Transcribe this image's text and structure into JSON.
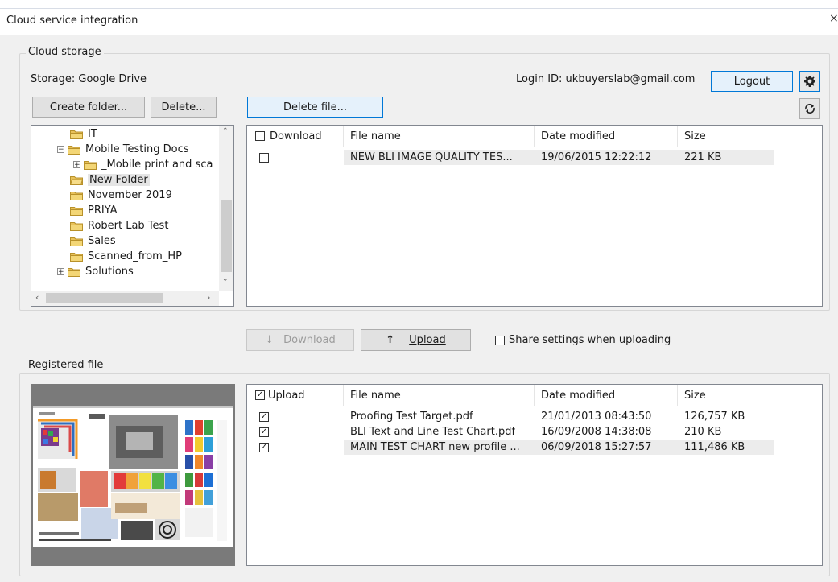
{
  "window": {
    "title": "Cloud service integration",
    "close_glyph": "×"
  },
  "cloud_storage": {
    "group_label": "Cloud storage",
    "storage_label": "Storage: Google Drive",
    "login_id": "Login ID: ukbuyerslab@gmail.com",
    "logout_label": "Logout",
    "create_folder_label": "Create folder...",
    "delete_label": "Delete...",
    "delete_file_label": "Delete file...",
    "tree": [
      {
        "label": "IT",
        "expander": ""
      },
      {
        "label": "Mobile Testing Docs",
        "expander": "−"
      },
      {
        "label": "_Mobile print and sca",
        "expander": "+"
      },
      {
        "label": "New Folder",
        "expander": "",
        "selected": true,
        "open": true
      },
      {
        "label": "November 2019",
        "expander": ""
      },
      {
        "label": "PRIYA",
        "expander": ""
      },
      {
        "label": "Robert Lab Test",
        "expander": ""
      },
      {
        "label": "Sales",
        "expander": ""
      },
      {
        "label": "Scanned_from_HP",
        "expander": ""
      },
      {
        "label": "Solutions",
        "expander": "+"
      }
    ],
    "file_columns": [
      "Download",
      "File name",
      "Date modified",
      "Size"
    ],
    "files": [
      {
        "name": "NEW BLI IMAGE QUALITY TES...",
        "date": "19/06/2015 12:22:12",
        "size": "221 KB",
        "checked": false
      }
    ]
  },
  "transfer": {
    "download_label": "Download",
    "upload_label": "Upload",
    "share_label": "Share settings when uploading"
  },
  "registered": {
    "group_label": "Registered file",
    "columns": [
      "Upload",
      "File name",
      "Date modified",
      "Size"
    ],
    "files": [
      {
        "name": "Proofing Test Target.pdf",
        "date": "21/01/2013 08:43:50",
        "size": "126,757 KB",
        "checked": true
      },
      {
        "name": "BLI Text and Line Test Chart.pdf",
        "date": "16/09/2008 14:38:08",
        "size": "210 KB",
        "checked": true
      },
      {
        "name": "MAIN TEST CHART new profile ...",
        "date": "06/09/2018 15:27:57",
        "size": "111,486 KB",
        "checked": true
      }
    ]
  },
  "colors": {
    "accent": "#0078d7",
    "panel_border": "#828790",
    "dialog_bg": "#f0f0f0"
  },
  "icons": [
    "close-icon",
    "gear-icon",
    "refresh-icon",
    "folder-icon",
    "down-arrow-icon",
    "up-arrow-icon",
    "scroll-left-icon",
    "scroll-right-icon",
    "scroll-up-icon",
    "scroll-down-icon",
    "checkmark-icon"
  ]
}
